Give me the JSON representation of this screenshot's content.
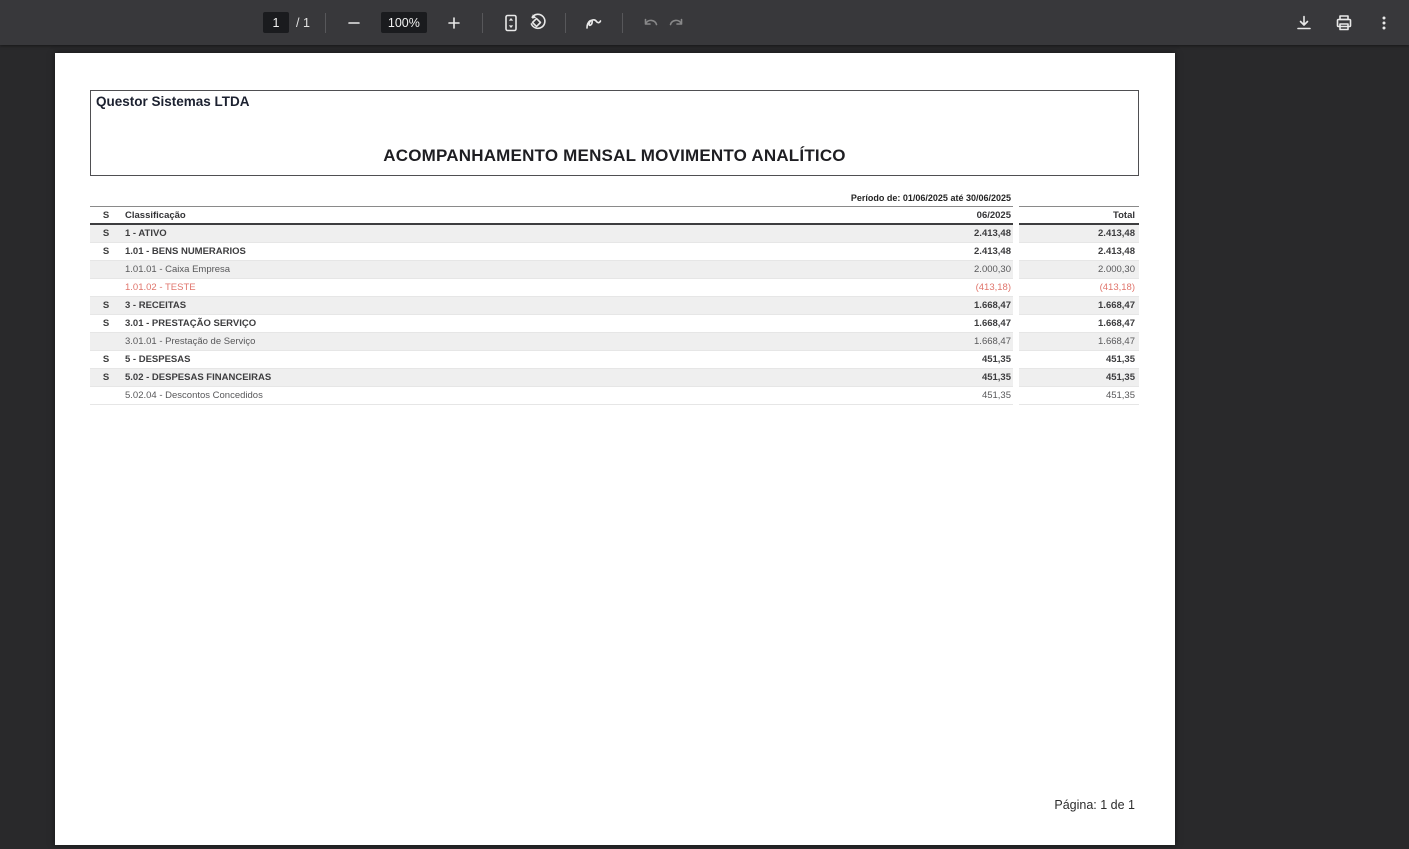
{
  "viewer": {
    "toolbar": {
      "page_current": "1",
      "page_total_label": "/ 1",
      "zoom_level": "100%",
      "icons": [
        "zoom-out",
        "zoom-in",
        "fit-to-page",
        "rotate-counterclockwise",
        "draw-annotate",
        "undo",
        "redo",
        "download",
        "print",
        "more-options"
      ],
      "toolbar_bg": "#38383b",
      "field_bg": "#1a1b1e"
    }
  },
  "document": {
    "company_name": "Questor Sistemas LTDA",
    "title": "ACOMPANHAMENTO MENSAL MOVIMENTO ANALÍTICO",
    "period": "Período de: 01/06/2025 até 30/06/2025",
    "footer": "Página: 1 de 1",
    "colors": {
      "negative_text": "#e0756c",
      "shaded_row": "#efefef"
    },
    "table": {
      "headers": {
        "s": "S",
        "classification": "Classificação",
        "month": "06/2025",
        "total": "Total"
      },
      "rows": [
        {
          "s": "S",
          "classification": "1 - ATIVO",
          "month": "2.413,48",
          "total": "2.413,48",
          "bold": true,
          "shaded": true,
          "negative": false
        },
        {
          "s": "S",
          "classification": "1.01 - BENS NUMERARIOS",
          "month": "2.413,48",
          "total": "2.413,48",
          "bold": true,
          "shaded": false,
          "negative": false
        },
        {
          "s": "",
          "classification": "1.01.01 - Caixa Empresa",
          "month": "2.000,30",
          "total": "2.000,30",
          "bold": false,
          "shaded": true,
          "negative": false
        },
        {
          "s": "",
          "classification": "1.01.02 - TESTE",
          "month": "(413,18)",
          "total": "(413,18)",
          "bold": false,
          "shaded": false,
          "negative": true
        },
        {
          "s": "S",
          "classification": "3 - RECEITAS",
          "month": "1.668,47",
          "total": "1.668,47",
          "bold": true,
          "shaded": true,
          "negative": false
        },
        {
          "s": "S",
          "classification": "3.01 - PRESTAÇÃO SERVIÇO",
          "month": "1.668,47",
          "total": "1.668,47",
          "bold": true,
          "shaded": false,
          "negative": false
        },
        {
          "s": "",
          "classification": "3.01.01 - Prestação de Serviço",
          "month": "1.668,47",
          "total": "1.668,47",
          "bold": false,
          "shaded": true,
          "negative": false
        },
        {
          "s": "S",
          "classification": "5 - DESPESAS",
          "month": "451,35",
          "total": "451,35",
          "bold": true,
          "shaded": false,
          "negative": false
        },
        {
          "s": "S",
          "classification": "5.02 - DESPESAS FINANCEIRAS",
          "month": "451,35",
          "total": "451,35",
          "bold": true,
          "shaded": true,
          "negative": false
        },
        {
          "s": "",
          "classification": "5.02.04 - Descontos Concedidos",
          "month": "451,35",
          "total": "451,35",
          "bold": false,
          "shaded": false,
          "negative": false
        }
      ]
    }
  }
}
